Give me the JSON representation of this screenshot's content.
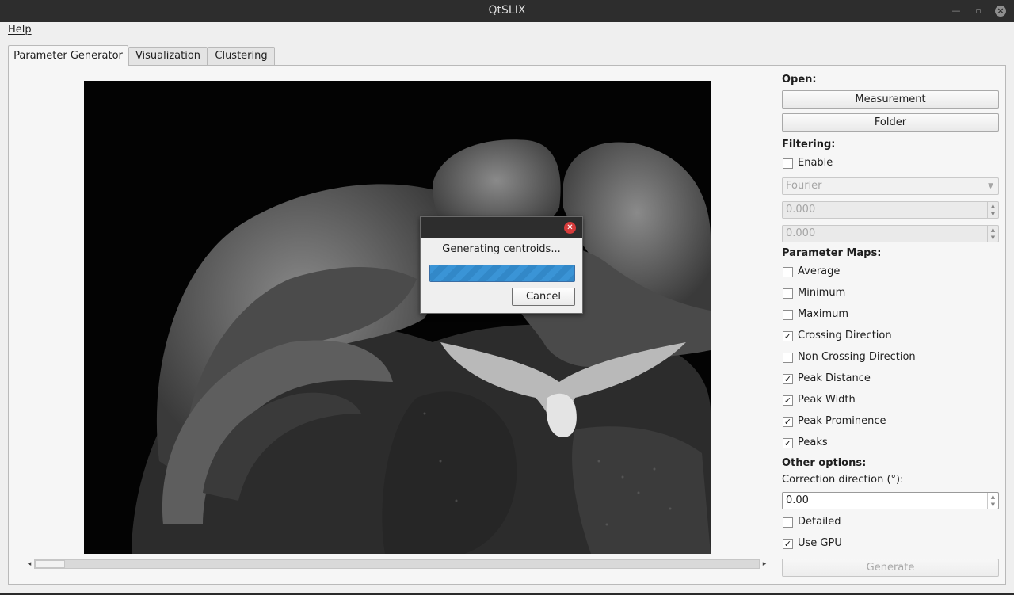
{
  "window": {
    "title": "QtSLIX"
  },
  "menu": {
    "help": "Help"
  },
  "tabs": [
    {
      "label": "Parameter Generator",
      "active": true
    },
    {
      "label": "Visualization",
      "active": false
    },
    {
      "label": "Clustering",
      "active": false
    }
  ],
  "sidebar": {
    "open_heading": "Open:",
    "measurement_button": "Measurement",
    "folder_button": "Folder",
    "filtering_heading": "Filtering:",
    "filter_enable": {
      "label": "Enable",
      "checked": false
    },
    "filter_type": {
      "value": "Fourier",
      "enabled": false
    },
    "filter_value_1": "0.000",
    "filter_value_2": "0.000",
    "param_maps_heading": "Parameter Maps:",
    "param_maps": [
      {
        "label": "Average",
        "checked": false
      },
      {
        "label": "Minimum",
        "checked": false
      },
      {
        "label": "Maximum",
        "checked": false
      },
      {
        "label": "Crossing Direction",
        "checked": true
      },
      {
        "label": "Non Crossing Direction",
        "checked": false
      },
      {
        "label": "Peak Distance",
        "checked": true
      },
      {
        "label": "Peak Width",
        "checked": true
      },
      {
        "label": "Peak Prominence",
        "checked": true
      },
      {
        "label": "Peaks",
        "checked": true
      }
    ],
    "other_heading": "Other options:",
    "correction_label": "Correction direction (°):",
    "correction_value": "0.00",
    "detailed": {
      "label": "Detailed",
      "checked": false
    },
    "use_gpu": {
      "label": "Use GPU",
      "checked": true
    },
    "generate_button": "Generate"
  },
  "progress_dialog": {
    "message": "Generating centroids...",
    "cancel_button": "Cancel",
    "progress_fraction": 1.0
  },
  "icons": {
    "window_minimize": "minimize-icon",
    "window_restore": "restore-icon",
    "window_close": "close-icon",
    "dialog_close": "close-icon",
    "checkmark": "✓"
  }
}
